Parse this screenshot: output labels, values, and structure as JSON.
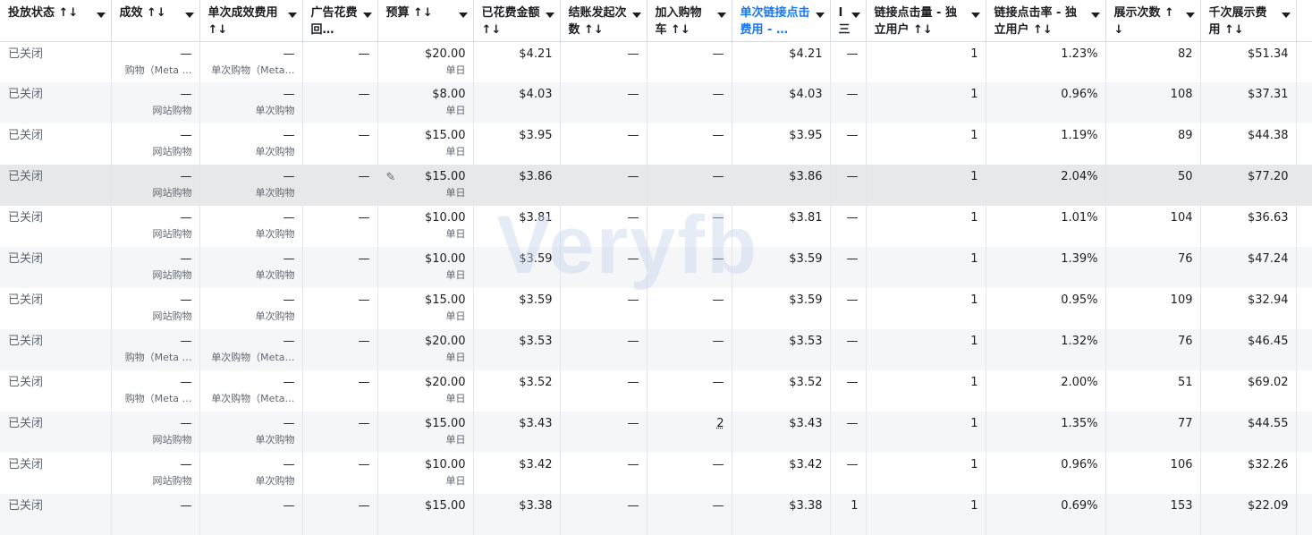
{
  "columns": [
    {
      "label": "投放状态 ↑↓",
      "w": 124
    },
    {
      "label": "成效 ↑↓",
      "w": 99
    },
    {
      "label": "单次成效费用 ↑↓",
      "w": 115
    },
    {
      "label": "广告花费回…",
      "w": 84
    },
    {
      "label": "预算 ↑↓",
      "w": 107
    },
    {
      "label": "已花费金额 ↑↓",
      "w": 97
    },
    {
      "label": "结账发起次数 ↑↓",
      "w": 97
    },
    {
      "label": "加入购物车 ↑↓",
      "w": 95
    },
    {
      "label": "单次链接点击费用 - …",
      "w": 110,
      "accent": true
    },
    {
      "label": "I 三",
      "w": 40
    },
    {
      "label": "链接点击量 - 独立用户 ↑↓",
      "w": 134
    },
    {
      "label": "链接点击率 - 独立用户 ↑↓",
      "w": 134
    },
    {
      "label": "展示次数 ↑↓",
      "w": 106
    },
    {
      "label": "千次展示费用 ↑↓",
      "w": 107
    },
    {
      "label": "",
      "w": 18
    }
  ],
  "rows": [
    {
      "status": "已关闭",
      "results": "—",
      "results_sub": "购物（Meta …",
      "cpr": "—",
      "cpr_sub": "单次购物（Meta…",
      "roas": "—",
      "budget": "$20.00",
      "budget_sub": "单日",
      "spent": "$4.21",
      "checkout": "—",
      "cart": "—",
      "cpc": "$4.21",
      "col9": "—",
      "clicks": "1",
      "ctr": "1.23%",
      "impr": "82",
      "cpm": "$51.34"
    },
    {
      "status": "已关闭",
      "results": "—",
      "results_sub": "网站购物",
      "cpr": "—",
      "cpr_sub": "单次购物",
      "roas": "—",
      "budget": "$8.00",
      "budget_sub": "单日",
      "spent": "$4.03",
      "checkout": "—",
      "cart": "—",
      "cpc": "$4.03",
      "col9": "—",
      "clicks": "1",
      "ctr": "0.96%",
      "impr": "108",
      "cpm": "$37.31"
    },
    {
      "status": "已关闭",
      "results": "—",
      "results_sub": "网站购物",
      "cpr": "—",
      "cpr_sub": "单次购物",
      "roas": "—",
      "budget": "$15.00",
      "budget_sub": "单日",
      "spent": "$3.95",
      "checkout": "—",
      "cart": "—",
      "cpc": "$3.95",
      "col9": "—",
      "clicks": "1",
      "ctr": "1.19%",
      "impr": "89",
      "cpm": "$44.38"
    },
    {
      "status": "已关闭",
      "results": "—",
      "results_sub": "网站购物",
      "cpr": "—",
      "cpr_sub": "单次购物",
      "roas": "—",
      "budget": "$15.00",
      "budget_sub": "单日",
      "spent": "$3.86",
      "checkout": "—",
      "cart": "—",
      "cpc": "$3.86",
      "col9": "—",
      "clicks": "1",
      "ctr": "2.04%",
      "impr": "50",
      "cpm": "$77.20",
      "highlight": true
    },
    {
      "status": "已关闭",
      "results": "—",
      "results_sub": "网站购物",
      "cpr": "—",
      "cpr_sub": "单次购物",
      "roas": "—",
      "budget": "$10.00",
      "budget_sub": "单日",
      "spent": "$3.81",
      "checkout": "—",
      "cart": "—",
      "cpc": "$3.81",
      "col9": "—",
      "clicks": "1",
      "ctr": "1.01%",
      "impr": "104",
      "cpm": "$36.63"
    },
    {
      "status": "已关闭",
      "results": "—",
      "results_sub": "网站购物",
      "cpr": "—",
      "cpr_sub": "单次购物",
      "roas": "—",
      "budget": "$10.00",
      "budget_sub": "单日",
      "spent": "$3.59",
      "checkout": "—",
      "cart": "—",
      "cpc": "$3.59",
      "col9": "—",
      "clicks": "1",
      "ctr": "1.39%",
      "impr": "76",
      "cpm": "$47.24"
    },
    {
      "status": "已关闭",
      "results": "—",
      "results_sub": "网站购物",
      "cpr": "—",
      "cpr_sub": "单次购物",
      "roas": "—",
      "budget": "$15.00",
      "budget_sub": "单日",
      "spent": "$3.59",
      "checkout": "—",
      "cart": "—",
      "cpc": "$3.59",
      "col9": "—",
      "clicks": "1",
      "ctr": "0.95%",
      "impr": "109",
      "cpm": "$32.94"
    },
    {
      "status": "已关闭",
      "results": "—",
      "results_sub": "购物（Meta …",
      "cpr": "—",
      "cpr_sub": "单次购物（Meta…",
      "roas": "—",
      "budget": "$20.00",
      "budget_sub": "单日",
      "spent": "$3.53",
      "checkout": "—",
      "cart": "—",
      "cpc": "$3.53",
      "col9": "—",
      "clicks": "1",
      "ctr": "1.32%",
      "impr": "76",
      "cpm": "$46.45"
    },
    {
      "status": "已关闭",
      "results": "—",
      "results_sub": "购物（Meta …",
      "cpr": "—",
      "cpr_sub": "单次购物（Meta…",
      "roas": "—",
      "budget": "$20.00",
      "budget_sub": "单日",
      "spent": "$3.52",
      "checkout": "—",
      "cart": "—",
      "cpc": "$3.52",
      "col9": "—",
      "clicks": "1",
      "ctr": "2.00%",
      "impr": "51",
      "cpm": "$69.02"
    },
    {
      "status": "已关闭",
      "results": "—",
      "results_sub": "网站购物",
      "cpr": "—",
      "cpr_sub": "单次购物",
      "roas": "—",
      "budget": "$15.00",
      "budget_sub": "单日",
      "spent": "$3.43",
      "checkout": "—",
      "cart": "2",
      "cpc": "$3.43",
      "col9": "—",
      "clicks": "1",
      "ctr": "1.35%",
      "impr": "77",
      "cpm": "$44.55"
    },
    {
      "status": "已关闭",
      "results": "—",
      "results_sub": "网站购物",
      "cpr": "—",
      "cpr_sub": "单次购物",
      "roas": "—",
      "budget": "$10.00",
      "budget_sub": "单日",
      "spent": "$3.42",
      "checkout": "—",
      "cart": "—",
      "cpc": "$3.42",
      "col9": "—",
      "clicks": "1",
      "ctr": "0.96%",
      "impr": "106",
      "cpm": "$32.26"
    },
    {
      "status": "已关闭",
      "results": "—",
      "results_sub": "",
      "cpr": "—",
      "cpr_sub": "",
      "roas": "—",
      "budget": "$15.00",
      "budget_sub": "",
      "spent": "$3.38",
      "checkout": "—",
      "cart": "—",
      "cpc": "$3.38",
      "col9": "1",
      "clicks": "1",
      "ctr": "0.69%",
      "impr": "153",
      "cpm": "$22.09"
    }
  ],
  "watermark": "Veryfb"
}
